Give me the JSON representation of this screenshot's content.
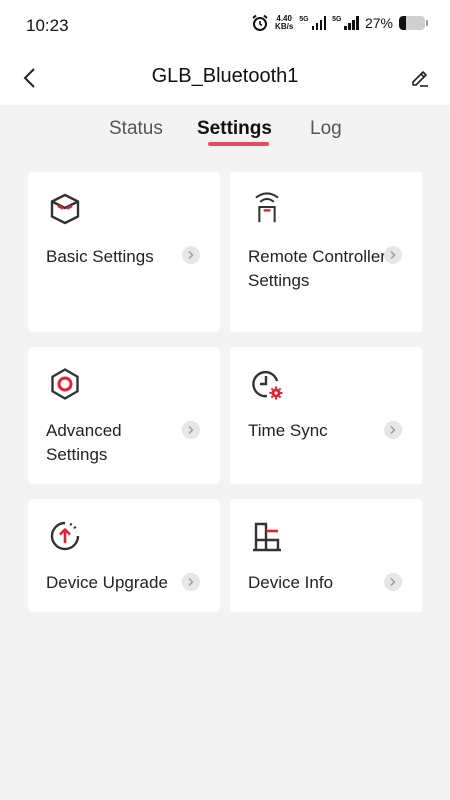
{
  "status_bar": {
    "time": "10:23",
    "net_speed_value": "4.40",
    "net_speed_unit": "KB/s",
    "network1": "5G",
    "network2": "5G",
    "battery_text": "27%",
    "battery_level": 0.27,
    "icons": [
      "alarm-icon",
      "signal-icon",
      "battery-icon"
    ]
  },
  "header": {
    "title": "GLB_Bluetooth1",
    "back_icon": "chevron-left-icon",
    "edit_icon": "pencil-icon"
  },
  "tabs": [
    {
      "label": "Status",
      "active": false
    },
    {
      "label": "Settings",
      "active": true
    },
    {
      "label": "Log",
      "active": false
    }
  ],
  "cards": [
    {
      "label": "Basic Settings",
      "icon": "cube-icon"
    },
    {
      "label": "Remote Controller Settings",
      "icon": "remote-controller-icon"
    },
    {
      "label": "Advanced Settings",
      "icon": "hexagon-gear-icon"
    },
    {
      "label": "Time Sync",
      "icon": "clock-gear-icon"
    },
    {
      "label": "Device Upgrade",
      "icon": "upgrade-arrow-icon"
    },
    {
      "label": "Device Info",
      "icon": "device-info-icon"
    }
  ],
  "colors": {
    "accent": "#e2232e",
    "tab_underline": "#e84a5f",
    "background": "#f3f3f3",
    "card": "#ffffff",
    "icon_dark": "#333333"
  }
}
